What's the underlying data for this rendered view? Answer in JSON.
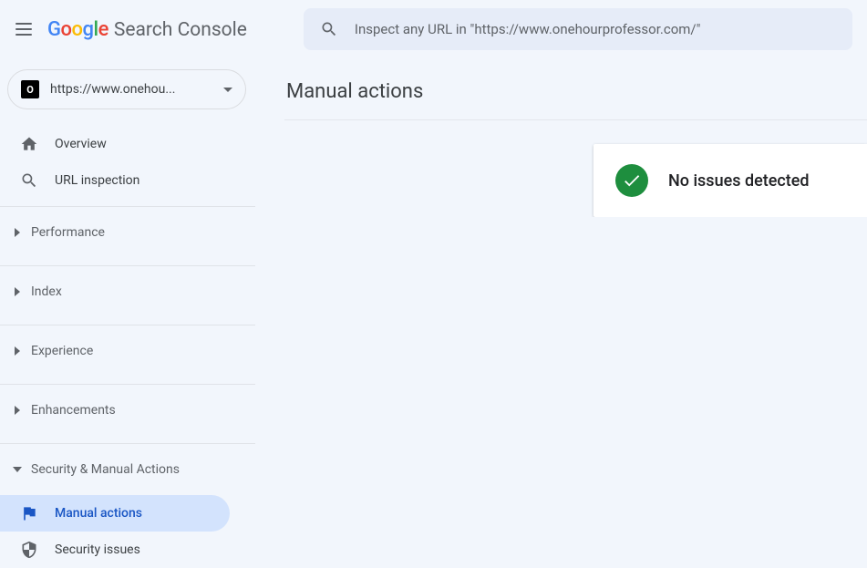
{
  "header": {
    "product": "Search Console",
    "search_placeholder": "Inspect any URL in \"https://www.onehourprofessor.com/\""
  },
  "sidebar": {
    "property_url": "https://www.onehou...",
    "nav": {
      "overview": "Overview",
      "url_inspection": "URL inspection"
    },
    "sections": {
      "performance": "Performance",
      "index": "Index",
      "experience": "Experience",
      "enhancements": "Enhancements",
      "security": "Security & Manual Actions"
    },
    "security_items": {
      "manual_actions": "Manual actions",
      "security_issues": "Security issues"
    }
  },
  "main": {
    "title": "Manual actions",
    "status": "No issues detected"
  }
}
